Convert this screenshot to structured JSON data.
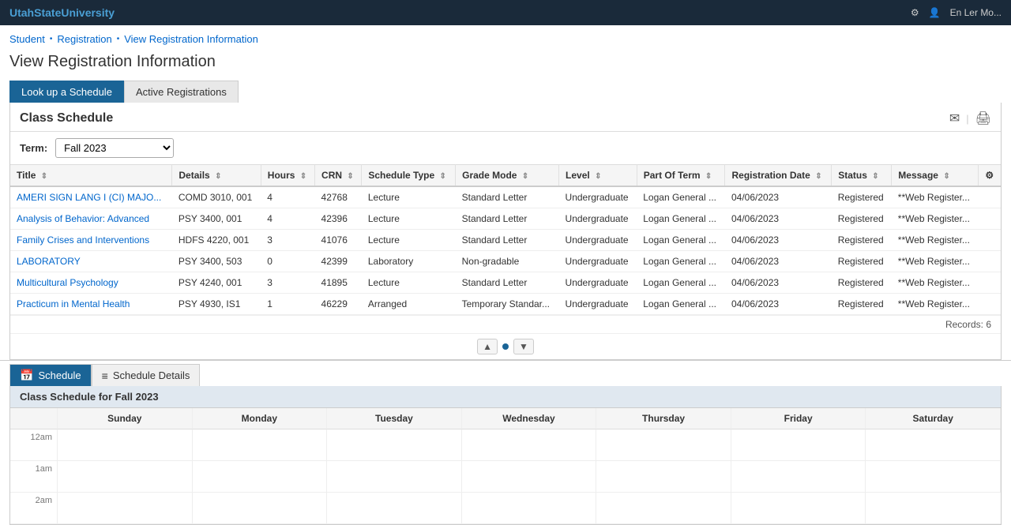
{
  "topbar": {
    "logo_prefix": "Utah",
    "logo_suffix": "StateUniversity",
    "settings_icon": "⚙",
    "user_icon": "👤",
    "user_label": "En Ler Mo..."
  },
  "breadcrumb": {
    "items": [
      {
        "label": "Student",
        "href": "#"
      },
      {
        "label": "Registration",
        "href": "#"
      },
      {
        "label": "View Registration Information",
        "href": "#"
      }
    ]
  },
  "page_title": "View Registration Information",
  "tabs": [
    {
      "label": "Look up a Schedule",
      "active": true
    },
    {
      "label": "Active Registrations",
      "active": false
    }
  ],
  "class_schedule": {
    "title": "Class Schedule",
    "term_label": "Term:",
    "term_value": "Fall 2023",
    "email_icon": "✉",
    "print_icon": "🖨",
    "columns": [
      {
        "label": "Title"
      },
      {
        "label": "Details"
      },
      {
        "label": "Hours"
      },
      {
        "label": "CRN"
      },
      {
        "label": "Schedule Type"
      },
      {
        "label": "Grade Mode"
      },
      {
        "label": "Level"
      },
      {
        "label": "Part Of Term"
      },
      {
        "label": "Registration Date"
      },
      {
        "label": "Status"
      },
      {
        "label": "Message"
      },
      {
        "label": "⚙"
      }
    ],
    "rows": [
      {
        "title": "AMERI SIGN LANG I (CI) MAJO...",
        "details": "COMD 3010, 001",
        "hours": "4",
        "crn": "42768",
        "schedule_type": "Lecture",
        "grade_mode": "Standard Letter",
        "level": "Undergraduate",
        "part_of_term": "Logan General ...",
        "reg_date": "04/06/2023",
        "status": "Registered",
        "message": "**Web Register..."
      },
      {
        "title": "Analysis of Behavior: Advanced",
        "details": "PSY 3400, 001",
        "hours": "4",
        "crn": "42396",
        "schedule_type": "Lecture",
        "grade_mode": "Standard Letter",
        "level": "Undergraduate",
        "part_of_term": "Logan General ...",
        "reg_date": "04/06/2023",
        "status": "Registered",
        "message": "**Web Register..."
      },
      {
        "title": "Family Crises and Interventions",
        "details": "HDFS 4220, 001",
        "hours": "3",
        "crn": "41076",
        "schedule_type": "Lecture",
        "grade_mode": "Standard Letter",
        "level": "Undergraduate",
        "part_of_term": "Logan General ...",
        "reg_date": "04/06/2023",
        "status": "Registered",
        "message": "**Web Register..."
      },
      {
        "title": "LABORATORY",
        "details": "PSY 3400, 503",
        "hours": "0",
        "crn": "42399",
        "schedule_type": "Laboratory",
        "grade_mode": "Non-gradable",
        "level": "Undergraduate",
        "part_of_term": "Logan General ...",
        "reg_date": "04/06/2023",
        "status": "Registered",
        "message": "**Web Register..."
      },
      {
        "title": "Multicultural Psychology",
        "details": "PSY 4240, 001",
        "hours": "3",
        "crn": "41895",
        "schedule_type": "Lecture",
        "grade_mode": "Standard Letter",
        "level": "Undergraduate",
        "part_of_term": "Logan General ...",
        "reg_date": "04/06/2023",
        "status": "Registered",
        "message": "**Web Register..."
      },
      {
        "title": "Practicum in Mental Health",
        "details": "PSY 4930, IS1",
        "hours": "1",
        "crn": "46229",
        "schedule_type": "Arranged",
        "grade_mode": "Temporary Standar...",
        "level": "Undergraduate",
        "part_of_term": "Logan General ...",
        "reg_date": "04/06/2023",
        "status": "Registered",
        "message": "**Web Register..."
      }
    ],
    "records_label": "Records: 6"
  },
  "bottom_tabs": [
    {
      "label": "Schedule",
      "icon": "📅",
      "active": true
    },
    {
      "label": "Schedule Details",
      "icon": "≡",
      "active": false
    }
  ],
  "calendar": {
    "header": "Class Schedule for Fall 2023",
    "days": [
      "Sunday",
      "Monday",
      "Tuesday",
      "Wednesday",
      "Thursday",
      "Friday",
      "Saturday"
    ],
    "times": [
      "12am",
      "1am",
      "2am"
    ]
  }
}
